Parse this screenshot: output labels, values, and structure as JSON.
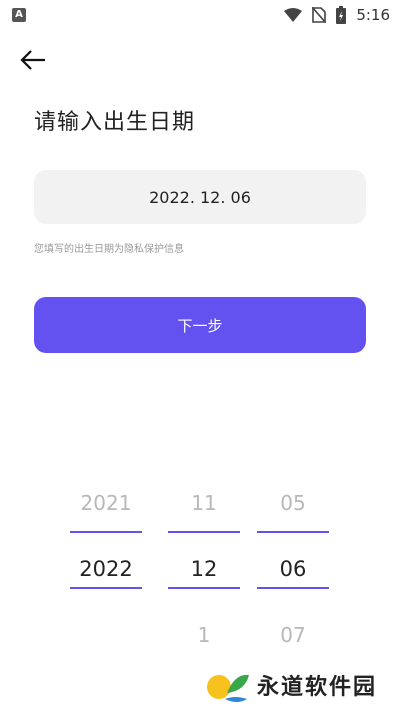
{
  "status_bar": {
    "time": "5:16",
    "icons": [
      "notification-a-icon",
      "wifi-icon",
      "no-sim-icon",
      "battery-charging-icon"
    ]
  },
  "header": {
    "back_icon": "arrow-left-icon"
  },
  "page": {
    "title": "请输入出生日期",
    "date_value": "2022. 12. 06",
    "hint": "您填写的出生日期为隐私保护信息",
    "next_label": "下一步"
  },
  "picker": {
    "year": {
      "prev": "2021",
      "selected": "2022",
      "next": ""
    },
    "month": {
      "prev": "11",
      "selected": "12",
      "next": "1"
    },
    "day": {
      "prev": "05",
      "selected": "06",
      "next": "07"
    }
  },
  "watermark": {
    "text": "永道软件园"
  },
  "colors": {
    "accent": "#6352f0",
    "field_bg": "#f2f2f2",
    "hint": "#999999"
  }
}
